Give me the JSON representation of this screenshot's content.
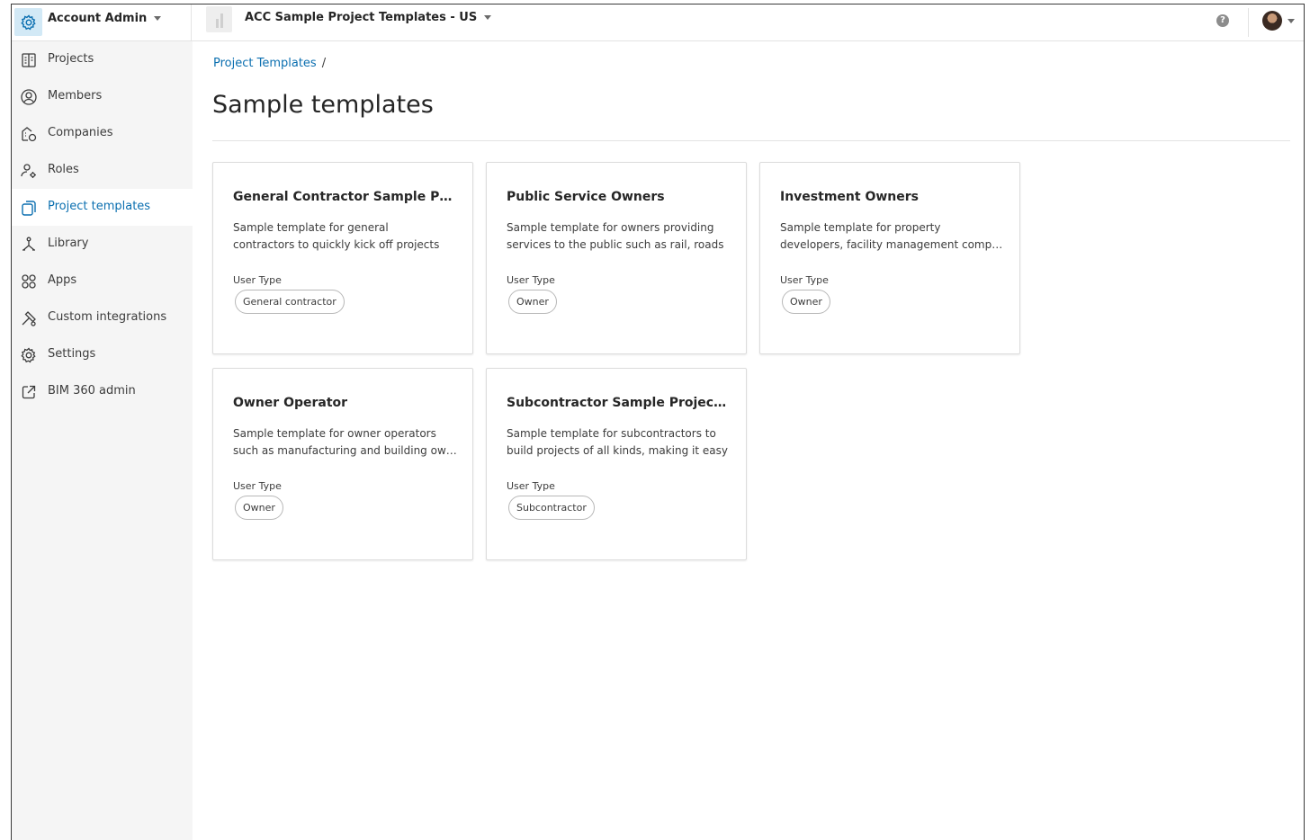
{
  "topbar": {
    "app_title": "Account Admin",
    "project_title": "ACC Sample Project Templates - US",
    "help_glyph": "?"
  },
  "sidebar": {
    "items": [
      {
        "label": "Projects",
        "icon": "building-icon"
      },
      {
        "label": "Members",
        "icon": "person-icon"
      },
      {
        "label": "Companies",
        "icon": "companies-icon"
      },
      {
        "label": "Roles",
        "icon": "roles-icon"
      },
      {
        "label": "Project templates",
        "icon": "template-icon",
        "active": true
      },
      {
        "label": "Library",
        "icon": "library-icon"
      },
      {
        "label": "Apps",
        "icon": "apps-icon"
      },
      {
        "label": "Custom integrations",
        "icon": "integrations-icon"
      },
      {
        "label": "Settings",
        "icon": "gear-icon"
      },
      {
        "label": "BIM 360 admin",
        "icon": "external-link-icon"
      }
    ]
  },
  "main": {
    "breadcrumb": {
      "link": "Project Templates",
      "separator": "/"
    },
    "title": "Sample templates",
    "cards": [
      {
        "title": "General Contractor Sample Project Template",
        "desc_line1": "Sample template for general",
        "desc_line2": "contractors to quickly kick off projects",
        "user_type_label": "User Type",
        "user_type": "General contractor"
      },
      {
        "title": "Public Service Owners",
        "desc_line1": "Sample template for owners providing",
        "desc_line2": "services to the public such as rail, roads",
        "user_type_label": "User Type",
        "user_type": "Owner"
      },
      {
        "title": "Investment Owners",
        "desc_line1": "Sample template for property",
        "desc_line2": "developers, facility management companies",
        "user_type_label": "User Type",
        "user_type": "Owner"
      },
      {
        "title": "Owner Operator",
        "desc_line1": "Sample template for owner operators",
        "desc_line2": "such as manufacturing and building owners",
        "user_type_label": "User Type",
        "user_type": "Owner"
      },
      {
        "title": "Subcontractor Sample Project Template",
        "desc_line1": "Sample template for subcontractors to",
        "desc_line2": "build projects of all kinds, making it easy",
        "user_type_label": "User Type",
        "user_type": "Subcontractor"
      }
    ]
  },
  "colors": {
    "accent": "#0b6fb0",
    "app_icon_bg": "#d2e9f6",
    "sidebar_bg": "#f5f5f5"
  }
}
